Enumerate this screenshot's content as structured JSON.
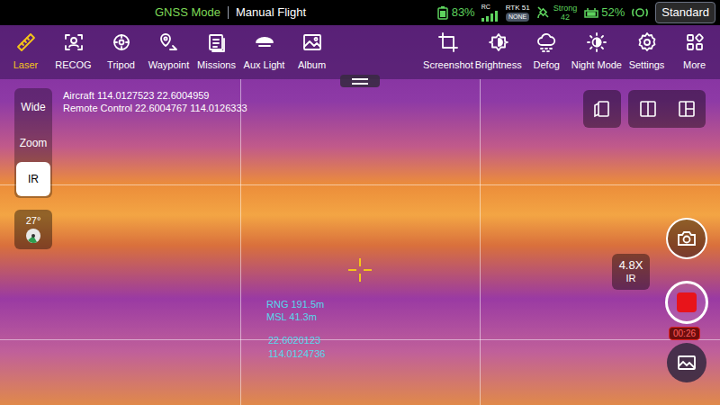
{
  "status_bar": {
    "gnss_mode": "GNSS Mode",
    "flight_mode": "Manual Flight",
    "aircraft_battery": "83%",
    "rc_label": "RC",
    "rtk": "RTK 51",
    "rtk_status": "NONE",
    "signal": "Strong",
    "signal_value": "42",
    "rc_battery": "52%",
    "profile": "Standard"
  },
  "toolbar_left": [
    {
      "label": "Laser",
      "selected": true
    },
    {
      "label": "RECOG",
      "selected": false
    },
    {
      "label": "Tripod",
      "selected": false
    },
    {
      "label": "Waypoint",
      "selected": false
    },
    {
      "label": "Missions",
      "selected": false
    },
    {
      "label": "Aux Light",
      "selected": false
    },
    {
      "label": "Album",
      "selected": false
    }
  ],
  "toolbar_right": [
    {
      "label": "Screenshot"
    },
    {
      "label": "Brightness"
    },
    {
      "label": "Defog"
    },
    {
      "label": "Night Mode"
    },
    {
      "label": "Settings"
    },
    {
      "label": "More"
    }
  ],
  "position": {
    "aircraft": "Aircraft 114.0127523 22.6004959",
    "remote": "Remote Control 22.6004767 114.0126333"
  },
  "lenses": [
    {
      "label": "Wide",
      "selected": false
    },
    {
      "label": "Zoom",
      "selected": false
    },
    {
      "label": "IR",
      "selected": true
    }
  ],
  "gimbal": {
    "angle": "27°"
  },
  "laser": {
    "range": "RNG 191.5m",
    "msl": "MSL 41.3m",
    "lat": "22.6020123",
    "lon": "114.0124736"
  },
  "zoom": {
    "factor": "4.8X",
    "lens": "IR"
  },
  "recording": {
    "on": true,
    "time": "00:26"
  }
}
